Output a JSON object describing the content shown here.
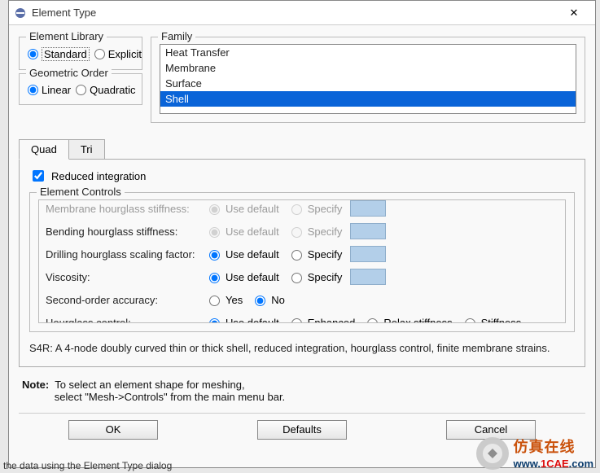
{
  "titlebar": {
    "title": "Element Type",
    "close": "✕"
  },
  "element_library": {
    "legend": "Element Library",
    "standard": "Standard",
    "explicit": "Explicit"
  },
  "geometric_order": {
    "legend": "Geometric Order",
    "linear": "Linear",
    "quadratic": "Quadratic"
  },
  "family": {
    "legend": "Family",
    "items": [
      "Heat Transfer",
      "Membrane",
      "Surface",
      "Shell"
    ],
    "selected": "Shell"
  },
  "tabs": {
    "quad": "Quad",
    "tri": "Tri"
  },
  "reduced_integration": "Reduced integration",
  "element_controls": {
    "legend": "Element Controls",
    "membrane": {
      "label": "Membrane hourglass stiffness:",
      "opt1": "Use default",
      "opt2": "Specify"
    },
    "bending": {
      "label": "Bending hourglass stiffness:",
      "opt1": "Use default",
      "opt2": "Specify"
    },
    "drilling": {
      "label": "Drilling hourglass scaling factor:",
      "opt1": "Use default",
      "opt2": "Specify"
    },
    "viscosity": {
      "label": "Viscosity:",
      "opt1": "Use default",
      "opt2": "Specify"
    },
    "second_order": {
      "label": "Second-order accuracy:",
      "yes": "Yes",
      "no": "No"
    },
    "hourglass": {
      "label": "Hourglass control:",
      "opt1": "Use default",
      "opt2": "Enhanced",
      "opt3": "Relax stiffness",
      "opt4": "Stiffness"
    }
  },
  "description": "S4R:  A 4-node doubly curved thin or thick shell, reduced integration, hourglass control, finite membrane strains.",
  "note": {
    "label": "Note:",
    "line1": "To select an element shape for meshing,",
    "line2": "select \"Mesh->Controls\" from the main menu bar."
  },
  "buttons": {
    "ok": "OK",
    "defaults": "Defaults",
    "cancel": "Cancel"
  },
  "bottom_cut": "the data using the Element Type dialog",
  "watermark": {
    "text1": "仿真在线",
    "url_pre": "www.",
    "url_main": "1CAE",
    "url_post": ".com"
  },
  "watermark2": "1CAE.COM"
}
